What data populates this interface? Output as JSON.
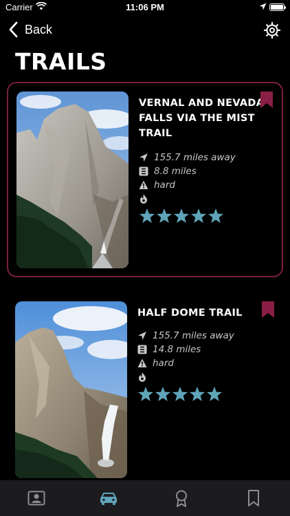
{
  "status_bar": {
    "carrier": "Carrier",
    "time": "11:06 PM"
  },
  "nav": {
    "back_label": "Back"
  },
  "page": {
    "title": "TRAILS"
  },
  "trails": [
    {
      "name": "VERNAL AND NEVADA FALLS VIA THE MIST TRAIL",
      "distance_away": "155.7 miles away",
      "length": "8.8 miles",
      "difficulty": "hard",
      "rating": 5,
      "bookmarked": true,
      "selected": true
    },
    {
      "name": "HALF DOME TRAIL",
      "distance_away": "155.7 miles away",
      "length": "14.8 miles",
      "difficulty": "hard",
      "rating": 5,
      "bookmarked": true,
      "selected": false
    }
  ],
  "tab_bar": {
    "active_index": 1
  },
  "colors": {
    "accent": "#8a1f45",
    "star": "#5fa4b8",
    "tab_active": "#5fa4b8",
    "tab_inactive": "#8e8e93",
    "meta_text": "#c8c8c8",
    "tab_bar_bg": "#1c1c1e"
  }
}
